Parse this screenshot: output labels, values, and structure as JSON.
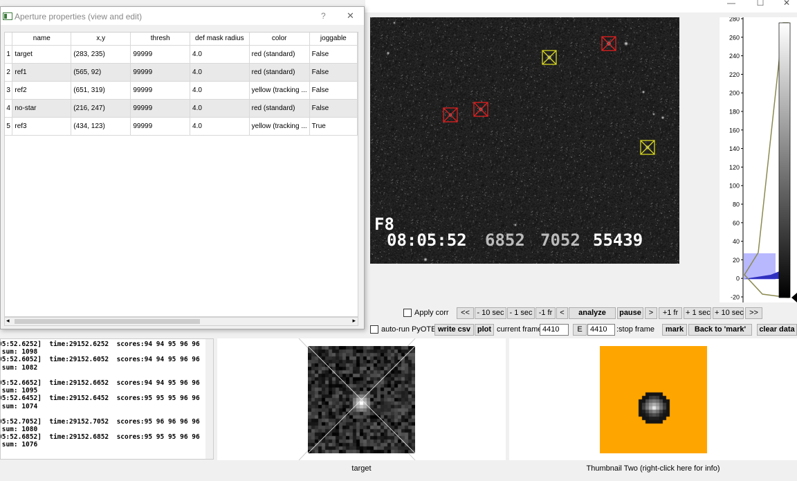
{
  "window": {
    "minimize": "—",
    "maximize": "☐",
    "close": "✕"
  },
  "overlay": {
    "frame_tag": "F8",
    "timestamp": "08:05:52",
    "field1": "6852",
    "field2": "7052",
    "field3": "55439"
  },
  "histogram": {
    "ticks": [
      "280",
      "260",
      "240",
      "220",
      "200",
      "180",
      "160",
      "140",
      "120",
      "100",
      "80",
      "60",
      "40",
      "20",
      "0",
      "-20"
    ]
  },
  "controls_row1": {
    "apply_corr_label": "Apply corr",
    "buttons": [
      "<<",
      "- 10 sec",
      "- 1 sec",
      "-1 fr",
      "<",
      "analyze",
      "pause",
      ">",
      "+1 fr",
      "+ 1 sec",
      "+ 10 sec",
      ">>"
    ]
  },
  "controls_row2": {
    "auto_run_label": "auto-run PyOTE",
    "write_csv": "write csv",
    "plot": "plot",
    "current_frame_label": "current frame:",
    "current_frame_value": "4410",
    "e_button": "E",
    "stop_frame_value": "4410",
    "stop_frame_label": ":stop frame",
    "mark": "mark",
    "back_to_mark": "Back to 'mark'",
    "clear_data": "clear data"
  },
  "log_lines": [
    "05:52.6252]  time:29152.6252  scores:94 94 95 96 96",
    " sum: 1098",
    "05:52.6052]  time:29152.6052  scores:94 94 95 96 96",
    " sum: 1082",
    "",
    "05:52.6652]  time:29152.6652  scores:94 94 95 96 96",
    " sum: 1095",
    "05:52.6452]  time:29152.6452  scores:95 95 95 96 96",
    " sum: 1074",
    "",
    "05:52.7052]  time:29152.7052  scores:95 96 96 96 96",
    " sum: 1080",
    "05:52.6852]  time:29152.6852  scores:95 95 95 96 96",
    " sum: 1076"
  ],
  "thumb1": {
    "label": "target"
  },
  "thumb2": {
    "label": "Thumbnail Two (right-click here for info)",
    "bg_color": "#ffa500"
  },
  "dialog": {
    "title": "Aperture properties (view and edit)",
    "help": "?",
    "close": "✕",
    "columns": [
      "name",
      "x,y",
      "thresh",
      "def mask radius",
      "color",
      "joggable"
    ],
    "rows": [
      [
        "1",
        "target",
        "(283, 235)",
        "99999",
        "4.0",
        "red (standard)",
        "False"
      ],
      [
        "2",
        "ref1",
        "(565, 92)",
        "99999",
        "4.0",
        "red (standard)",
        "False"
      ],
      [
        "3",
        "ref2",
        "(651, 319)",
        "99999",
        "4.0",
        "yellow (tracking ...",
        "False"
      ],
      [
        "4",
        "no-star",
        "(216, 247)",
        "99999",
        "4.0",
        "red (standard)",
        "False"
      ],
      [
        "5",
        "ref3",
        "(434, 123)",
        "99999",
        "4.0",
        "yellow (tracking ...",
        "True"
      ]
    ]
  },
  "colors": {
    "aperture_red": "#e02020",
    "aperture_yellow": "#d8d820",
    "histo_fill": "#b8b8ff"
  }
}
